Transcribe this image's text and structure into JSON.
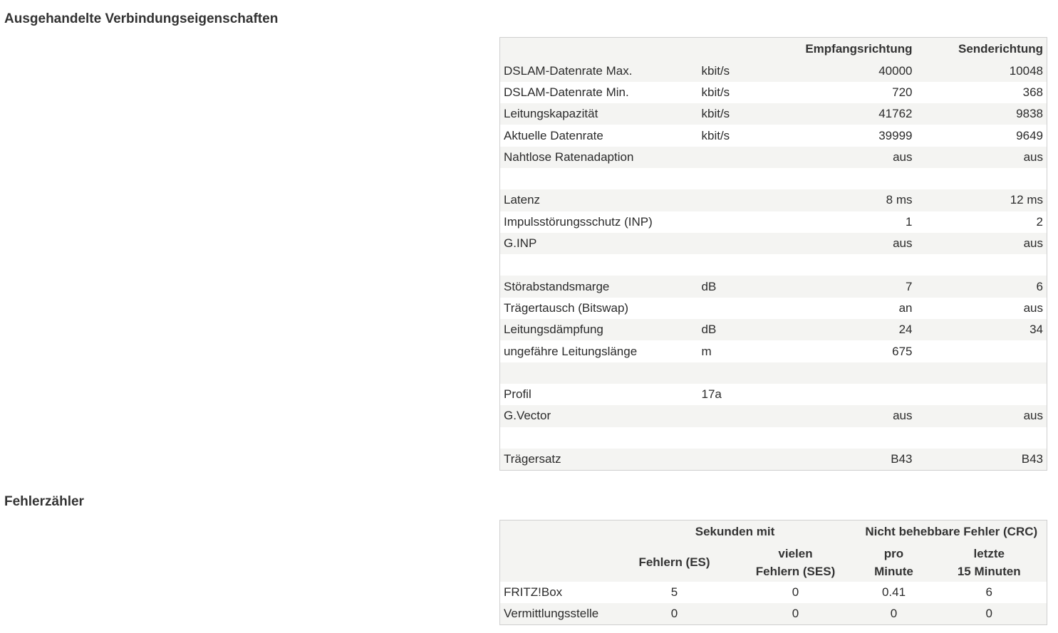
{
  "section1": {
    "title": "Ausgehandelte Verbindungseigenschaften",
    "headers": {
      "rx": "Empfangsrichtung",
      "tx": "Senderichtung"
    },
    "rows": [
      {
        "label": "DSLAM-Datenrate Max.",
        "unit": "kbit/s",
        "rx": "40000",
        "tx": "10048"
      },
      {
        "label": "DSLAM-Datenrate Min.",
        "unit": "kbit/s",
        "rx": "720",
        "tx": "368"
      },
      {
        "label": "Leitungskapazität",
        "unit": "kbit/s",
        "rx": "41762",
        "tx": "9838"
      },
      {
        "label": "Aktuelle Datenrate",
        "unit": "kbit/s",
        "rx": "39999",
        "tx": "9649"
      },
      {
        "label": "Nahtlose Ratenadaption",
        "unit": "",
        "rx": "aus",
        "tx": "aus"
      },
      {
        "label": "",
        "unit": "",
        "rx": "",
        "tx": ""
      },
      {
        "label": "Latenz",
        "unit": "",
        "rx": "8 ms",
        "tx": "12 ms"
      },
      {
        "label": "Impulsstörungsschutz (INP)",
        "unit": "",
        "rx": "1",
        "tx": "2"
      },
      {
        "label": "G.INP",
        "unit": "",
        "rx": "aus",
        "tx": "aus"
      },
      {
        "label": "",
        "unit": "",
        "rx": "",
        "tx": ""
      },
      {
        "label": "Störabstandsmarge",
        "unit": "dB",
        "rx": "7",
        "tx": "6"
      },
      {
        "label": "Trägertausch (Bitswap)",
        "unit": "",
        "rx": "an",
        "tx": "aus"
      },
      {
        "label": "Leitungsdämpfung",
        "unit": "dB",
        "rx": "24",
        "tx": "34"
      },
      {
        "label": "ungefähre Leitungslänge",
        "unit": "m",
        "rx": "675",
        "tx": ""
      },
      {
        "label": "",
        "unit": "",
        "rx": "",
        "tx": ""
      },
      {
        "label": "Profil",
        "unit": "17a",
        "rx": "",
        "tx": ""
      },
      {
        "label": "G.Vector",
        "unit": "",
        "rx": "aus",
        "tx": "aus"
      },
      {
        "label": "",
        "unit": "",
        "rx": "",
        "tx": ""
      },
      {
        "label": "Trägersatz",
        "unit": "",
        "rx": "B43",
        "tx": "B43"
      }
    ]
  },
  "section2": {
    "title": "Fehlerzähler",
    "group_headers": {
      "seconds": "Sekunden mit",
      "crc": "Nicht behebbare Fehler (CRC)"
    },
    "sub_headers": {
      "es": "Fehlern (ES)",
      "ses_1": "vielen",
      "ses_2": "Fehlern (SES)",
      "pm_1": "pro",
      "pm_2": "Minute",
      "l15_1": "letzte",
      "l15_2": "15 Minuten"
    },
    "rows": [
      {
        "label": "FRITZ!Box",
        "es": "5",
        "ses": "0",
        "per_minute": "0.41",
        "last15": "6"
      },
      {
        "label": "Vermittlungsstelle",
        "es": "0",
        "ses": "0",
        "per_minute": "0",
        "last15": "0"
      }
    ]
  }
}
